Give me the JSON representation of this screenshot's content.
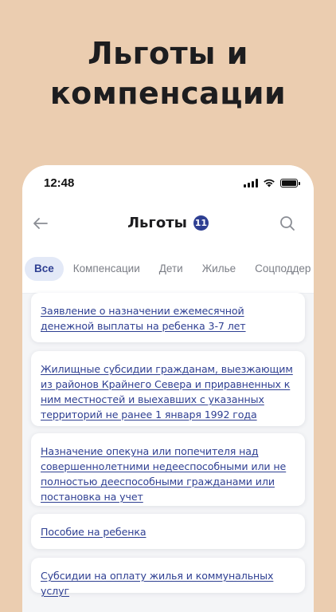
{
  "promo": {
    "title_line1": "Льготы и",
    "title_line2": "компенсации"
  },
  "status_bar": {
    "time": "12:48"
  },
  "nav": {
    "title": "Льготы",
    "badge_count": "11"
  },
  "tabs": [
    {
      "label": "Все",
      "active": true
    },
    {
      "label": "Компенсации",
      "active": false
    },
    {
      "label": "Дети",
      "active": false
    },
    {
      "label": "Жилье",
      "active": false
    },
    {
      "label": "Соцподдер",
      "active": false
    }
  ],
  "benefits": [
    {
      "title": "Заявление о назначении ежемесячной денежной выплаты на ребенка 3-7 лет"
    },
    {
      "title": "Жилищные субсидии гражданам, выезжающим из районов Крайнего Севера и приравненных к ним местностей и выехавших с указанных территорий не ранее 1 января 1992 года"
    },
    {
      "title": "Назначение опекуна или попечителя над совершеннолетними недееспособными или не полностью дееспособными гражданами или постановка на учет"
    },
    {
      "title": "Пособие на ребенка"
    },
    {
      "title": "Субсидии на оплату жилья и коммунальных услуг"
    }
  ],
  "colors": {
    "background": "#ebcdb0",
    "accent": "#2e3f92",
    "active_tab_bg": "#e3e9f7",
    "tab_text": "#7b7e86"
  },
  "icons": {
    "back": "arrow-left-icon",
    "search": "search-icon",
    "signal": "cellular-signal-icon",
    "wifi": "wifi-icon",
    "battery": "battery-icon"
  }
}
